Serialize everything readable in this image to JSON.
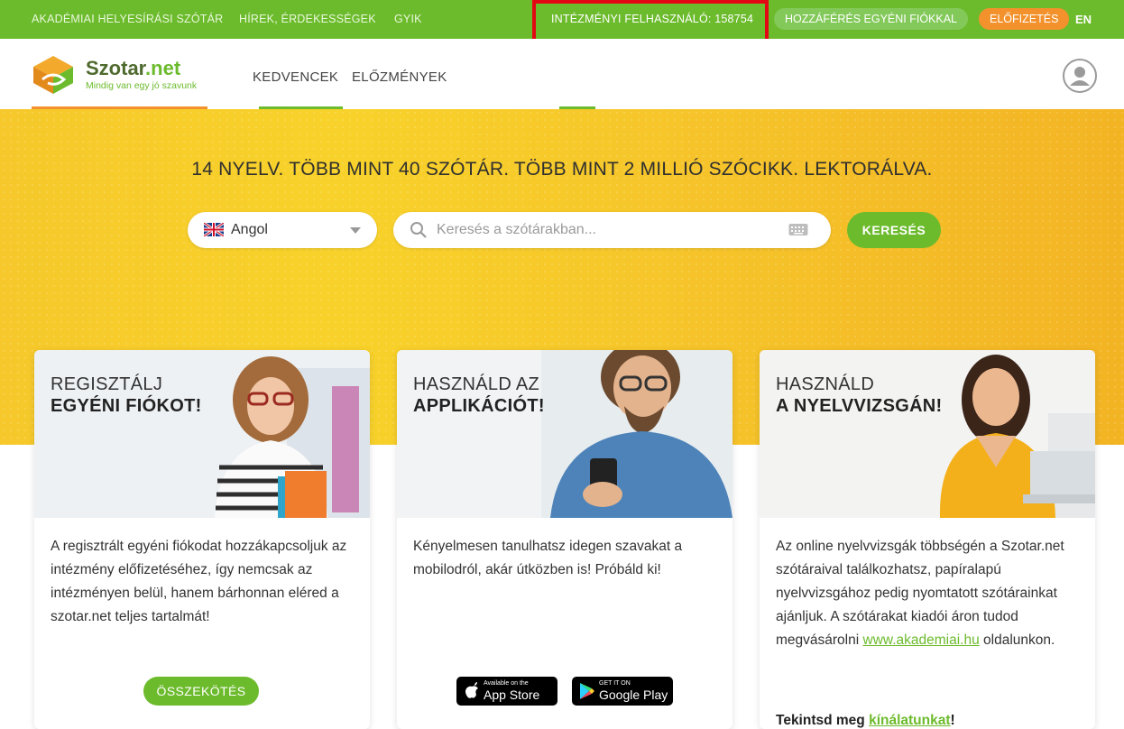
{
  "topbar": {
    "links": [
      "AKADÉMIAI HELYESÍRÁSI SZÓTÁR",
      "HÍREK, ÉRDEKESSÉGEK",
      "GYIK"
    ],
    "institutional_user": "INTÉZMÉNYI FELHASZNÁLÓ: 158754",
    "individual_access": "HOZZÁFÉRÉS EGYÉNI FIÓKKAL",
    "subscription": "ELŐFIZETÉS",
    "language": "EN"
  },
  "header": {
    "logo_title_a": "Szotar",
    "logo_title_b": ".net",
    "logo_tagline": "Mindig van egy jó szavunk",
    "nav": [
      "KEDVENCEK",
      "ELŐZMÉNYEK"
    ]
  },
  "hero": {
    "title": "14 NYELV. TÖBB MINT 40 SZÓTÁR. TÖBB MINT 2 MILLIÓ SZÓCIKK. LEKTORÁLVA.",
    "language_selected": "Angol",
    "search_placeholder": "Keresés a szótárakban...",
    "search_button": "KERESÉS"
  },
  "cards": [
    {
      "title_line1": "REGISZTÁLJ",
      "title_line2": "EGYÉNI FIÓKOT!",
      "body": "A regisztrált egyéni fiókodat hozzákapcsoljuk az intézmény előfizetéséhez, így nemcsak az intézményen belül, hanem bárhonnan eléred a szotar.net teljes tartalmát!",
      "button": "ÖSSZEKÖTÉS"
    },
    {
      "title_line1": "HASZNÁLD AZ",
      "title_line2": "APPLIKÁCIÓT!",
      "body": "Kényelmesen tanulhatsz idegen szavakat a mobilodról, akár útközben is! Próbáld ki!",
      "appstore_small": "Available on the",
      "appstore_big": "App Store",
      "googleplay_small": "GET IT ON",
      "googleplay_big": "Google Play"
    },
    {
      "title_line1": "HASZNÁLD",
      "title_line2": "A NYELVVIZSGÁN!",
      "body_text": "Az online nyelvvizsgák többségén a Szotar.net szótáraival találkozhatsz, papíralapú nyelvvizsgához pedig nyomtatott szótárainkat ajánljuk. A szótárakat kiadói áron tudod megvásárolni ",
      "body_link": "www.akademiai.hu",
      "body_tail": " oldalunkon.",
      "cta_prefix": "Tekintsd meg ",
      "cta_link": "kínálatunkat",
      "cta_suffix": "!"
    }
  ],
  "colors": {
    "brand_green": "#6cbb2c",
    "accent_orange": "#f3922c",
    "hero_yellow": "#f8d22a",
    "highlight_red": "#e30613"
  }
}
